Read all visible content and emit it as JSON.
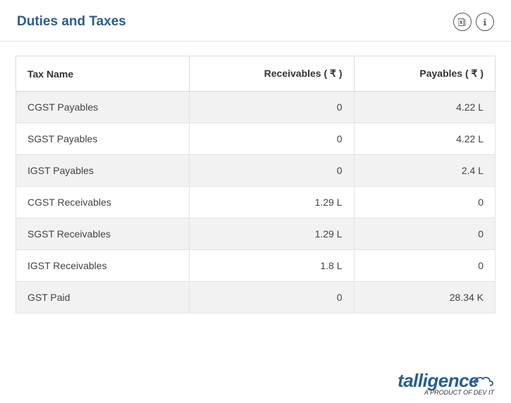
{
  "title": "Duties and Taxes",
  "columns": {
    "tax_name": "Tax Name",
    "receivables": "Receivables ( ₹ )",
    "payables": "Payables ( ₹ )"
  },
  "rows": [
    {
      "tax_name": "CGST Payables",
      "receivables": "0",
      "payables": "4.22 L"
    },
    {
      "tax_name": "SGST Payables",
      "receivables": "0",
      "payables": "4.22 L"
    },
    {
      "tax_name": "IGST Payables",
      "receivables": "0",
      "payables": "2.4 L"
    },
    {
      "tax_name": "CGST Receivables",
      "receivables": "1.29 L",
      "payables": "0"
    },
    {
      "tax_name": "SGST Receivables",
      "receivables": "1.29 L",
      "payables": "0"
    },
    {
      "tax_name": "IGST Receivables",
      "receivables": "1.8 L",
      "payables": "0"
    },
    {
      "tax_name": "GST Paid",
      "receivables": "0",
      "payables": "28.34 K"
    }
  ],
  "brand": {
    "name": "talligence",
    "tagline": "A PRODUCT OF DEV IT"
  }
}
